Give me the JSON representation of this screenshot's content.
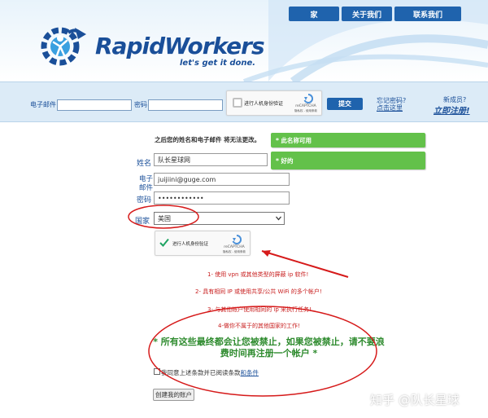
{
  "nav": {
    "home": "家",
    "about": "关于我们",
    "contact": "联系我们"
  },
  "brand": {
    "name": "RapidWorkers",
    "slogan": "let's get it done."
  },
  "login": {
    "email_label": "电子邮件",
    "password_label": "密码",
    "captcha_label": "进行人机身份验证",
    "submit_label": "提交",
    "forgot_line1": "忘记密码?",
    "forgot_line2": "点击这里",
    "new_member": "新成员?",
    "register": "立即注册!"
  },
  "captcha_brand": {
    "name": "reCAPTCHA",
    "terms": "隐私权 - 使用条款"
  },
  "form": {
    "note": "之后您的姓名和电子邮件 将无法更改。",
    "name_label": "姓名",
    "name_value": "队长星球网",
    "email_label_line1": "电子",
    "email_label_line2": "邮件",
    "email_value": "juijiini@guge.com",
    "password_label": "密码",
    "password_value": "••••••••••••",
    "country_label": "国家",
    "country_value": "美国",
    "captcha_label": "进行人机身份验证",
    "terms_text": "我同意上述条款并已阅读条款",
    "terms_link": "和条件",
    "create_button": "创建我的账户"
  },
  "validation": {
    "name_ok": "* 此名称可用",
    "email_ok": "* 好的"
  },
  "warnings": [
    "1- 使用 vpn 或其他类型的屏蔽 ip 软件!",
    "2- 具有相同 IP 或使用共享/公共 WiFi 的多个帐户!",
    "3- 与其他帐户使用相同的 ip 来执行任务!",
    "4-做你不属于的其他国家的工作!"
  ],
  "big_message": "* 所有这些最终都会让您被禁止，如果您被禁止，请不要浪费时间再注册一个帐户 *",
  "watermark": "知乎 @队长星球",
  "colors": {
    "nav_blue": "#1f63ad",
    "brand_blue": "#1a4f99",
    "valid_green": "#63c14a",
    "warning_red": "#c81e1e",
    "message_green": "#2e8b2e"
  }
}
